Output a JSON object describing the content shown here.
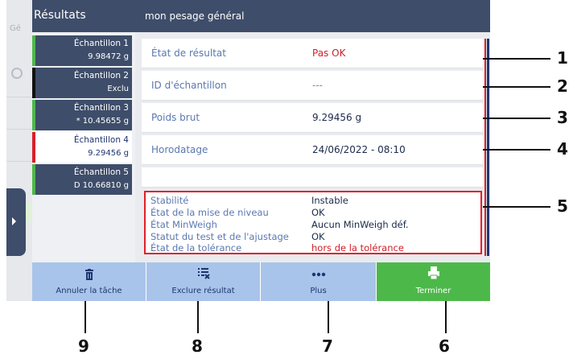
{
  "header": {
    "title": "Résultats",
    "subtitle": "mon pesage général"
  },
  "ghost": {
    "text": "Gé"
  },
  "samples": [
    {
      "name": "Échantillon 1",
      "value": "9.98472 g",
      "status_color": "#4db84a"
    },
    {
      "name": "Échantillon 2",
      "value": "Exclu",
      "status_color": "#111111"
    },
    {
      "name": "Échantillon 3",
      "value": "* 10.45655 g",
      "status_color": "#4db84a"
    },
    {
      "name": "Échantillon 4",
      "value": "9.29456 g",
      "status_color": "#d8202a",
      "selected": true
    },
    {
      "name": "Échantillon 5",
      "value": "D 10.66810 g",
      "status_color": "#4db84a"
    }
  ],
  "details": {
    "result_state": {
      "label": "État de résultat",
      "value": "Pas OK"
    },
    "sample_id": {
      "label": "ID d'échantillon",
      "value": "---"
    },
    "gross_weight": {
      "label": "Poids brut",
      "value": "9.29456 g"
    },
    "timestamp": {
      "label": "Horodatage",
      "value": "24/06/2022 - 08:10"
    },
    "checks": [
      {
        "label": "Stabilité",
        "value": "Instable"
      },
      {
        "label": "État de la mise de niveau",
        "value": "OK"
      },
      {
        "label": "État MinWeigh",
        "value": "Aucun MinWeigh déf."
      },
      {
        "label": "Statut du test et de l'ajustage",
        "value": "OK"
      },
      {
        "label": "État de la tolérance",
        "value": "hors de la tolérance"
      }
    ]
  },
  "footer": {
    "cancel_label": "Annuler la tâche",
    "exclude_label": "Exclure résultat",
    "more_label": "Plus",
    "finish_label": "Terminer"
  },
  "callouts": [
    "1",
    "2",
    "3",
    "4",
    "5",
    "6",
    "7",
    "8",
    "9"
  ],
  "colors": {
    "header": "#3e4d6a",
    "accent_red": "#d8202a",
    "ok_green": "#4db84a",
    "button_blue": "#a9c4ea"
  }
}
